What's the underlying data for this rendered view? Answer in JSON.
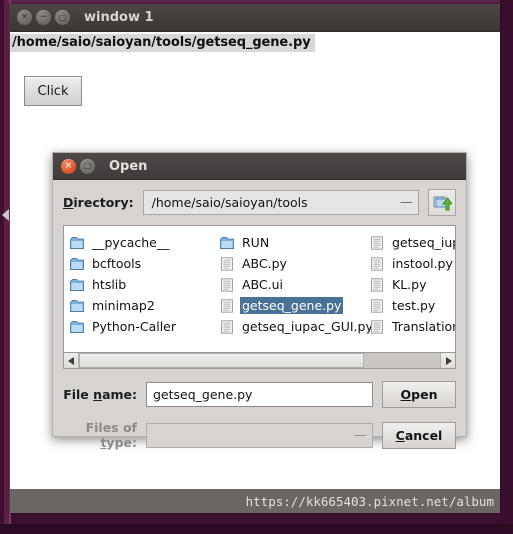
{
  "desktop": {
    "background_color": "#3d0f30"
  },
  "main_window": {
    "title": "window 1",
    "buttons": {
      "close": "×",
      "minimize": "−",
      "maximize": "□"
    },
    "path_text": "/home/saio/saioyan/tools/getseq_gene.py",
    "click_button": "Click"
  },
  "watermark": {
    "text": "https://kk665403.pixnet.net/album"
  },
  "dialog": {
    "title": "Open",
    "buttons": {
      "close": "×",
      "maximize": "□"
    },
    "directory": {
      "label": "Directory:",
      "label_mnemonic": "D",
      "value": "/home/saio/saioyan/tools",
      "dropdown_glyph": "—",
      "up_button_name": "go-up"
    },
    "file_list": {
      "selected": "getseq_gene.py",
      "columns": [
        [
          {
            "name": "__pycache__",
            "type": "folder"
          },
          {
            "name": "bcftools",
            "type": "folder"
          },
          {
            "name": "htslib",
            "type": "folder"
          },
          {
            "name": "minimap2",
            "type": "folder"
          },
          {
            "name": "Python-Caller",
            "type": "folder"
          }
        ],
        [
          {
            "name": "RUN",
            "type": "folder"
          },
          {
            "name": "ABC.py",
            "type": "file"
          },
          {
            "name": "ABC.ui",
            "type": "file"
          },
          {
            "name": "getseq_gene.py",
            "type": "file"
          },
          {
            "name": "getseq_iupac_GUI.py",
            "type": "file"
          }
        ],
        [
          {
            "name": "getseq_iupac_",
            "type": "file"
          },
          {
            "name": "instool.py",
            "type": "file"
          },
          {
            "name": "KL.py",
            "type": "file"
          },
          {
            "name": "test.py",
            "type": "file"
          },
          {
            "name": "Translation_v",
            "type": "file"
          }
        ]
      ]
    },
    "scrollbar": {
      "left_arrow": "◀",
      "right_arrow": "▶",
      "thumb_percent": 79
    },
    "file_name": {
      "label": "File name:",
      "value": "getseq_gene.py"
    },
    "files_of_type": {
      "label": "Files of type:",
      "value": "",
      "dropdown_glyph": "—",
      "disabled": true
    },
    "open_button": "Open",
    "cancel_button": "Cancel"
  },
  "colors": {
    "selection": "#4a7296",
    "titlebar": "#423e3c",
    "dialog_bg": "#d6d3d0",
    "close_red": "#e0532a",
    "desktop": "#3d0f30"
  }
}
